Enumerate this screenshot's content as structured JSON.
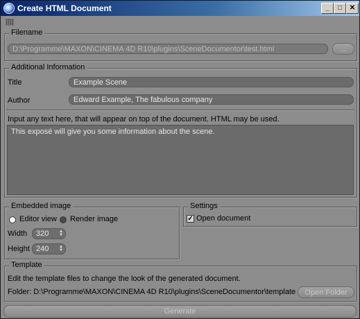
{
  "window": {
    "title": "Create HTML Document",
    "minimize_glyph": "_",
    "maximize_glyph": "□",
    "close_glyph": "✕"
  },
  "filename": {
    "group_title": "Filename",
    "path": "D:\\Programme\\MAXON\\CINEMA 4D R10\\plugins\\SceneDocumentor\\test.html",
    "browse_label": "..."
  },
  "additional_info": {
    "group_title": "Additional Information",
    "title_label": "Title",
    "title_value": "Example Scene",
    "author_label": "Author",
    "author_value": "Edward Example, The fabulous company",
    "hint": "Input any text here, that will appear on top of the document. HTML may be used.",
    "body_text": "This exposé will give you some information about the scene."
  },
  "embedded_image": {
    "group_title": "Embedded image",
    "options": [
      "Editor view",
      "Render image"
    ],
    "selected": "Editor view",
    "width_label": "Width",
    "width_value": "320",
    "height_label": "Height",
    "height_value": "240"
  },
  "settings": {
    "group_title": "Settings",
    "open_document_label": "Open document",
    "open_document_checked": true
  },
  "template": {
    "group_title": "Template",
    "hint": "Edit the template files to change the look of the generated document.",
    "folder_text": "Folder: D:\\Programme\\MAXON\\CINEMA 4D R10\\plugins\\SceneDocumentor\\template",
    "open_folder_label": "Open Folder"
  },
  "generate_label": "Generate"
}
